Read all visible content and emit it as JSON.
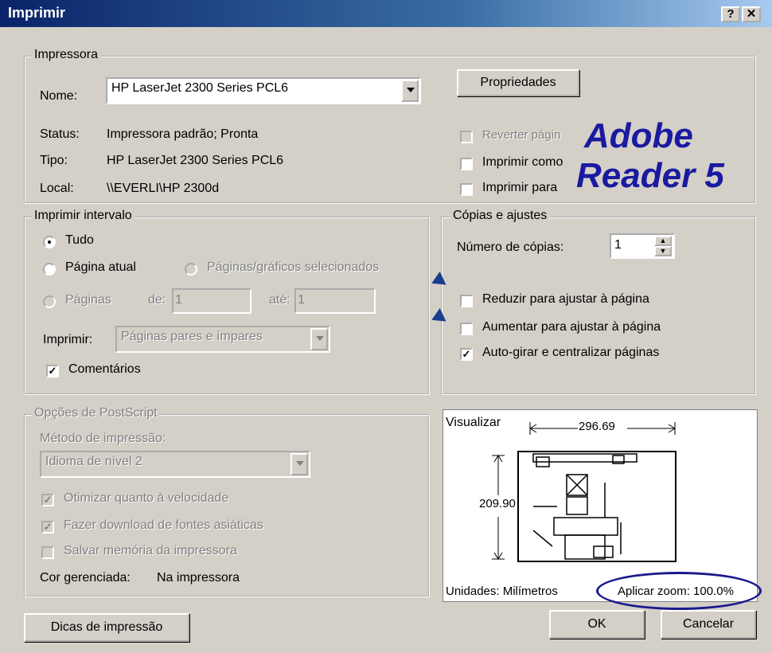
{
  "window": {
    "title": "Imprimir",
    "help_btn": "?",
    "close_btn": "✕"
  },
  "printer": {
    "group_label": "Impressora",
    "name_label": "Nome:",
    "name_value": "HP LaserJet 2300 Series PCL6",
    "status_label": "Status:",
    "status_value": "Impressora padrão; Pronta",
    "type_label": "Tipo:",
    "type_value": "HP LaserJet 2300 Series PCL6",
    "local_label": "Local:",
    "local_value": "\\\\EVERLI\\HP 2300d",
    "properties_btn": "Propriedades",
    "reverse_pages": "Reverter págin",
    "print_as": "Imprimir como",
    "print_to": "Imprimir para"
  },
  "watermark": {
    "line1": "Adobe",
    "line2": "Reader 5"
  },
  "range": {
    "group_label": "Imprimir intervalo",
    "all": "Tudo",
    "current_page": "Página atual",
    "selected": "Páginas/gráficos selecionados",
    "pages": "Páginas",
    "from_label": "de:",
    "from_value": "1",
    "to_label": "até:",
    "to_value": "1",
    "print_label": "Imprimir:",
    "print_value": "Páginas pares e ímpares",
    "comments": "Comentários"
  },
  "copies": {
    "group_label": "Cópias e ajustes",
    "count_label": "Número de cópias:",
    "count_value": "1",
    "shrink": "Reduzir para ajustar à página",
    "enlarge": "Aumentar para ajustar à página",
    "autorotate": "Auto-girar e centralizar páginas"
  },
  "postscript": {
    "group_label": "Opções de PostScript",
    "method_label": "Método de impressão:",
    "method_value": "Idioma de nível 2",
    "optimize": "Otimizar quanto à velocidade",
    "download_fonts": "Fazer download de fontes asiáticas",
    "save_memory": "Salvar memória da impressora",
    "color_label": "Cor gerenciada:",
    "color_value": "Na impressora"
  },
  "preview": {
    "label": "Visualizar",
    "width_value": "296.69",
    "height_value": "209.90",
    "units": "Unidades: Milímetros",
    "zoom": "Aplicar zoom: 100.0%"
  },
  "buttons": {
    "tips": "Dicas de impressão",
    "ok": "OK",
    "cancel": "Cancelar"
  },
  "state": {
    "range_selected": "all",
    "comments_checked": true,
    "autorotate_checked": true,
    "shrink_checked": false,
    "enlarge_checked": false,
    "optimize_checked": true,
    "download_fonts_checked": true,
    "save_memory_checked": false
  },
  "colors": {
    "titlebar": "#0a246a",
    "dialog_bg": "#d4d0c8",
    "watermark": "#1a1aa0",
    "zoom_highlight": "#1a1a8c"
  }
}
